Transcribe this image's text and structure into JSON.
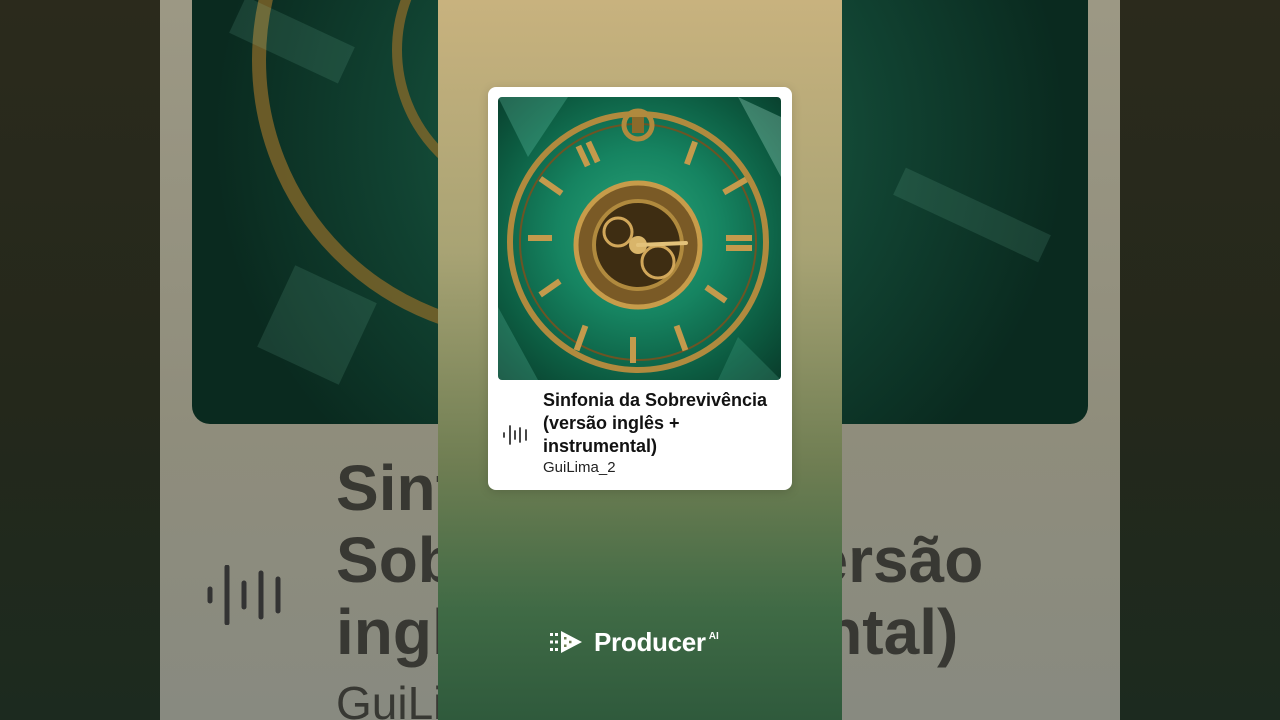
{
  "track": {
    "title": "Sinfonia da Sobrevivência (versão inglês + instrumental)",
    "artist": "GuiLima_2"
  },
  "background": {
    "title_lines": [
      "Sinf",
      "Sob                    ersão",
      "ingl                   ental)"
    ],
    "artist_fragment": "GuiLi"
  },
  "brand": {
    "name": "Producer",
    "suffix": "AI"
  },
  "icons": {
    "waveform": "audio-waveform-icon",
    "logo": "producer-logo-icon"
  },
  "colors": {
    "panel_top": "#c8b27e",
    "panel_bottom": "#2f5a3c",
    "cover_green": "#168461",
    "clock_gold": "#b08a3e"
  }
}
